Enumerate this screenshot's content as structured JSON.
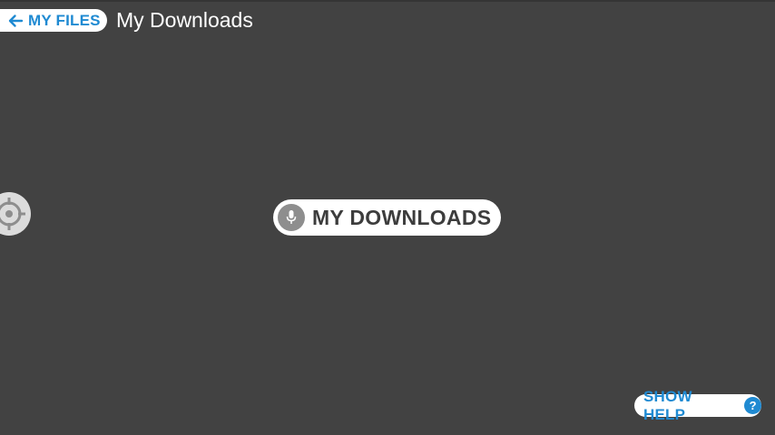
{
  "header": {
    "back_label": "MY FILES",
    "title": "My Downloads",
    "back_icon": "arrow-left-icon"
  },
  "main": {
    "location_label": "MY DOWNLOADS",
    "mic_icon": "microphone-icon",
    "target_icon": "crosshair-icon"
  },
  "footer": {
    "help_label": "SHOW HELP",
    "help_glyph": "?"
  },
  "colors": {
    "background": "#424242",
    "accent": "#1f8ad2",
    "pill": "#ffffff",
    "icon_gray": "#8e8e8e"
  }
}
